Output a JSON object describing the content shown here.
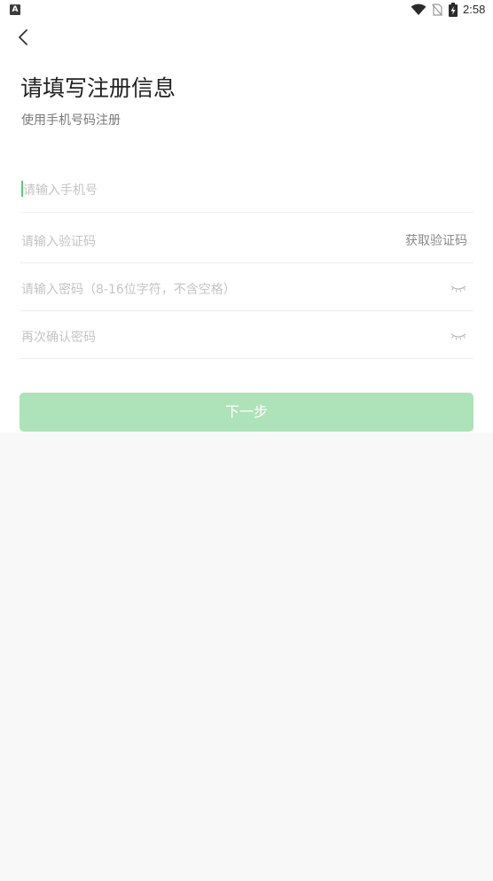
{
  "status_bar": {
    "app_icon_letter": "A",
    "time": "2:58"
  },
  "header": {
    "back_icon": "chevron-left-icon",
    "title": "请填写注册信息",
    "subtitle": "使用手机号码注册"
  },
  "form": {
    "phone": {
      "placeholder": "请输入手机号",
      "value": ""
    },
    "code": {
      "placeholder": "请输入验证码",
      "value": "",
      "get_code_label": "获取验证码"
    },
    "password": {
      "placeholder": "请输入密码（8-16位字符，不含空格）",
      "value": "",
      "toggle_icon": "eye-closed-icon"
    },
    "confirm": {
      "placeholder": "再次确认密码",
      "value": "",
      "toggle_icon": "eye-closed-icon"
    }
  },
  "actions": {
    "next_label": "下一步"
  },
  "colors": {
    "accent": "#5cc97a",
    "button_disabled": "#aee2b8",
    "background": "#f8f8f8"
  }
}
